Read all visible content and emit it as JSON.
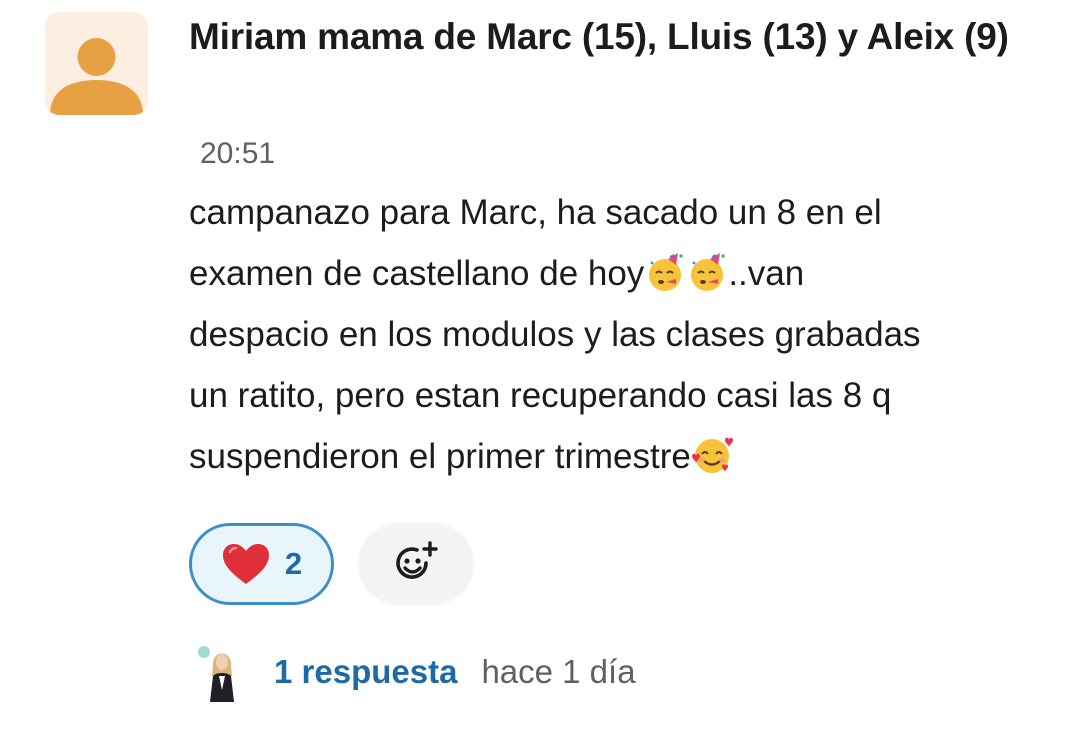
{
  "message": {
    "sender": "Miriam mama de Marc (15), Lluis (13) y Aleix (9)",
    "time": "20:51",
    "lines": [
      "campanazo para Marc, ha sacado un 8 en el",
      "examen de castellano de hoy",
      "..van",
      "despacio en los modulos y las clases grabadas",
      "un ratito, pero estan recuperando casi las 8 q",
      "suspendieron el primer trimestre"
    ],
    "inline_emojis": [
      "partying-face-icon",
      "partying-face-icon",
      "smiling-face-with-hearts-icon"
    ]
  },
  "reactions": [
    {
      "emoji": "red-heart-icon",
      "count": "2",
      "selected": true
    }
  ],
  "add_reaction_icon": "add-emoji-icon",
  "thread": {
    "reply_count_label": "1 respuesta",
    "last_reply": "hace 1 día"
  },
  "colors": {
    "link": "#1d6aa5",
    "reaction_border": "#3d8ec9",
    "reaction_bg": "#e8f5fa",
    "avatar_bg": "#fcefe2",
    "avatar_fg": "#e8a045",
    "muted_text": "#616061"
  }
}
